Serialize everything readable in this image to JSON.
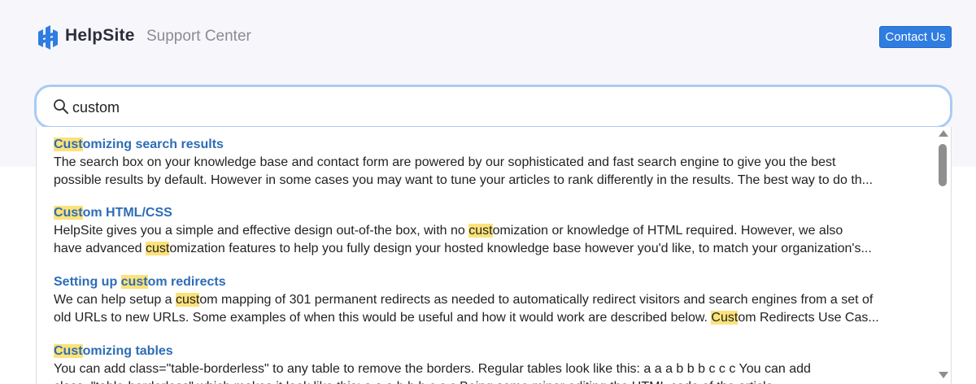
{
  "header": {
    "brand": "HelpSite",
    "subtitle": "Support Center",
    "contact_label": "Contact Us"
  },
  "search": {
    "query": "custom"
  },
  "results": [
    {
      "title": [
        [
          "Cust",
          true
        ],
        [
          "omizing search results",
          false
        ]
      ],
      "line1": [
        [
          "The search box on your knowledge base and contact form are powered by our sophisticated and fast search engine to give you the best",
          false
        ]
      ],
      "line2": [
        [
          "possible results by default. However in some cases you may want to tune your articles to rank differently in the results. The best way to do th...",
          false
        ]
      ]
    },
    {
      "title": [
        [
          "Cust",
          true
        ],
        [
          "om HTML/CSS",
          false
        ]
      ],
      "line1": [
        [
          "HelpSite gives you a simple and effective design out-of-the box, with no ",
          false
        ],
        [
          "cust",
          true
        ],
        [
          "omization or knowledge of HTML required. However, we also",
          false
        ]
      ],
      "line2": [
        [
          "have advanced ",
          false
        ],
        [
          "cust",
          true
        ],
        [
          "omization features to help you fully design your hosted knowledge base however you'd like, to match your organization's...",
          false
        ]
      ]
    },
    {
      "title": [
        [
          "Setting up ",
          false
        ],
        [
          "cust",
          true
        ],
        [
          "om redirects",
          false
        ]
      ],
      "line1": [
        [
          "We can help setup a ",
          false
        ],
        [
          "cust",
          true
        ],
        [
          "om mapping of 301 permanent redirects  as needed to automatically redirect visitors and search engines from a set of",
          false
        ]
      ],
      "line2": [
        [
          "old URLs to new URLs. Some examples of when this would be useful and how it would work are described below. ",
          false
        ],
        [
          "Cust",
          true
        ],
        [
          "om Redirects Use Cas...",
          false
        ]
      ]
    },
    {
      "title": [
        [
          "Cust",
          true
        ],
        [
          "omizing tables",
          false
        ]
      ],
      "line1": [
        [
          "You can add class=\"table-borderless\" to any table to remove the borders. Regular tables look like this: a a a b b b c c c You can add",
          false
        ]
      ],
      "line2": [
        [
          "class=\"table-borderless\" which makes it look like this: a a a b b b c c c Being some minor editing the HTML code of the article...",
          false
        ]
      ]
    }
  ],
  "colors": {
    "accent": "#2f7de1",
    "link": "#2d6db5",
    "highlight": "#fde27a",
    "search_border": "#a9cbf2",
    "hero_bg": "#f7f6fa"
  },
  "icons": {
    "logo": "helpsite-logo-icon",
    "search": "search-icon",
    "scroll_up": "scroll-up-arrow-icon",
    "scroll_down": "scroll-down-arrow-icon"
  }
}
